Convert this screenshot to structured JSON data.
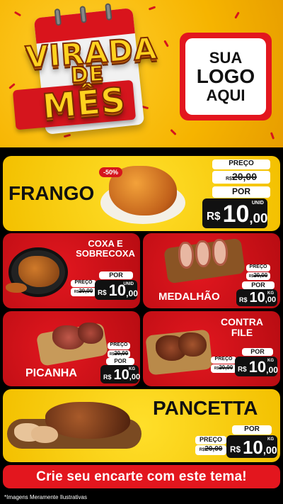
{
  "header": {
    "title_line1": "VIRADA",
    "title_line2": "DE",
    "title_line3": "MÊS",
    "logo_line1": "SUA",
    "logo_line2": "LOGO",
    "logo_line3": "AQUI"
  },
  "colors": {
    "brand_red": "#e3161e",
    "brand_yellow": "#f6b400",
    "price_black": "#111111"
  },
  "products": [
    {
      "name": "FRANGO",
      "badge": "-50%",
      "price_label": "PREÇO",
      "old_prefix": "R$",
      "old_price": "20,00",
      "por_label": "POR",
      "currency": "R$",
      "price_int": "10",
      "price_cents": ",00",
      "unit": "UNID",
      "image_icon": "roast-chicken-icon"
    },
    {
      "name_line1": "COXA E",
      "name_line2": "SOBRECOXA",
      "price_label": "PREÇO",
      "old_prefix": "R$",
      "old_price": "20,00",
      "por_label": "POR",
      "currency": "R$",
      "price_int": "10",
      "price_cents": ",00",
      "unit": "UNID",
      "image_icon": "chicken-thigh-pan-icon"
    },
    {
      "name": "MEDALHÃO",
      "price_label": "PREÇO",
      "old_prefix": "R$",
      "old_price": "20,00",
      "por_label": "POR",
      "currency": "R$",
      "price_int": "10",
      "price_cents": ",00",
      "unit": "KG",
      "image_icon": "bacon-skewers-icon"
    },
    {
      "name": "PICANHA",
      "price_label": "PREÇO",
      "old_prefix": "R$",
      "old_price": "20,00",
      "por_label": "POR",
      "currency": "R$",
      "price_int": "10",
      "price_cents": ",00",
      "unit": "KG",
      "image_icon": "sliced-steak-icon"
    },
    {
      "name_line1": "CONTRA",
      "name_line2": "FILE",
      "price_label": "PREÇO",
      "old_prefix": "R$",
      "old_price": "20,00",
      "por_label": "POR",
      "currency": "R$",
      "price_int": "10",
      "price_cents": ",00",
      "unit": "KG",
      "image_icon": "grilled-steak-icon"
    },
    {
      "name": "PANCETTA",
      "price_label": "PREÇO",
      "old_prefix": "R$",
      "old_price": "20,00",
      "por_label": "POR",
      "currency": "R$",
      "price_int": "10",
      "price_cents": ",00",
      "unit": "KG",
      "image_icon": "roasted-pork-belly-icon"
    }
  ],
  "banner": "Crie seu encarte com este tema!",
  "footnote": "*Imagens Meramente Ilustrativas"
}
